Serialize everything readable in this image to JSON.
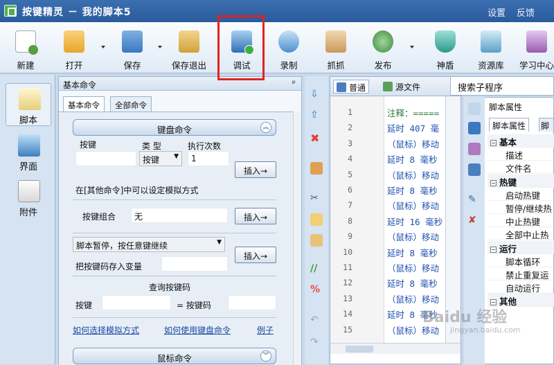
{
  "window": {
    "title": "按键精灵 － 我的脚本5",
    "links": [
      "设置",
      "反馈"
    ]
  },
  "toolbar": {
    "buttons": [
      {
        "label": "新建",
        "icon": "new-script-icon",
        "color": "#5a9e3c"
      },
      {
        "label": "打开",
        "icon": "open-folder-icon",
        "color": "#e9a62a"
      },
      {
        "label": "保存",
        "icon": "save-disk-icon",
        "color": "#3a78c2"
      },
      {
        "label": "保存退出",
        "icon": "save-exit-icon",
        "color": "#d0a13a"
      },
      {
        "label": "调试",
        "icon": "debug-icon",
        "color": "#2f6fb3"
      },
      {
        "label": "录制",
        "icon": "record-icon",
        "color": "#4a8fd0"
      },
      {
        "label": "抓抓",
        "icon": "grab-hand-icon",
        "color": "#c99a5b"
      },
      {
        "label": "发布",
        "icon": "publish-globe-icon",
        "color": "#3d8b3d"
      },
      {
        "label": "神盾",
        "icon": "shield-icon",
        "color": "#2a9a8a"
      },
      {
        "label": "资源库",
        "icon": "resource-library-icon",
        "color": "#5aa0c8"
      },
      {
        "label": "学习中心",
        "icon": "learning-center-icon",
        "color": "#9a5ab0"
      }
    ]
  },
  "leftnav": {
    "items": [
      "脚本",
      "界面",
      "附件"
    ]
  },
  "commands": {
    "panel_title": "基本命令",
    "pin": "ᵖ",
    "tabs": [
      "基本命令",
      "全部命令"
    ],
    "keyboard": {
      "header": "键盘命令",
      "col_key": "按键",
      "col_type": "类 型",
      "col_times": "执行次数",
      "type_value": "按键",
      "times_value": "1",
      "insert": "插入→",
      "hint": "在[其他命令]中可以设定模拟方式",
      "combo_label": "按键组合",
      "combo_value": "无",
      "pause_value": "脚本暂停，按任意键继续",
      "store_label": "把按键码存入变量",
      "query_title": "查询按键码",
      "query_key": "按键",
      "query_code": "= 按键码",
      "links": [
        "如何选择模拟方式",
        "如何使用键盘命令",
        "例子"
      ]
    },
    "mouse_header": "鼠标命令"
  },
  "editor": {
    "tabs": [
      "普通",
      "源文件"
    ],
    "line_numbers": [
      "1",
      "2",
      "3",
      "4",
      "5",
      "6",
      "7",
      "8",
      "9",
      "10",
      "11",
      "12",
      "13",
      "14",
      "15"
    ],
    "lines": [
      "注释：=====",
      "延时 407 毫",
      "（鼠标）移动",
      "延时 8 毫秒",
      "（鼠标）移动",
      "延时 8 毫秒",
      "（鼠标）移动",
      "延时 16 毫秒",
      "（鼠标）移动",
      "延时 8 毫秒",
      "（鼠标）移动",
      "延时 8 毫秒",
      "（鼠标）移动",
      "延时 8 毫秒",
      "（鼠标）移动"
    ]
  },
  "search": {
    "label": "搜索子程序"
  },
  "properties": {
    "title": "脚本属性",
    "tabs": [
      "脚本属性",
      "脚本"
    ],
    "rows": [
      {
        "cat": true,
        "text": "基本"
      },
      {
        "text": "描述"
      },
      {
        "text": "文件名"
      },
      {
        "cat": true,
        "text": "热键"
      },
      {
        "text": "启动热键"
      },
      {
        "text": "暂停/继续热"
      },
      {
        "text": "中止热键"
      },
      {
        "text": "全部中止热"
      },
      {
        "cat": true,
        "text": "运行"
      },
      {
        "text": "脚本循环"
      },
      {
        "text": "禁止重复运"
      },
      {
        "text": "自动运行"
      },
      {
        "cat": true,
        "text": "其他"
      }
    ]
  },
  "watermark": {
    "main": "Baidu 经验",
    "sub": "jingyan.baidu.com"
  }
}
